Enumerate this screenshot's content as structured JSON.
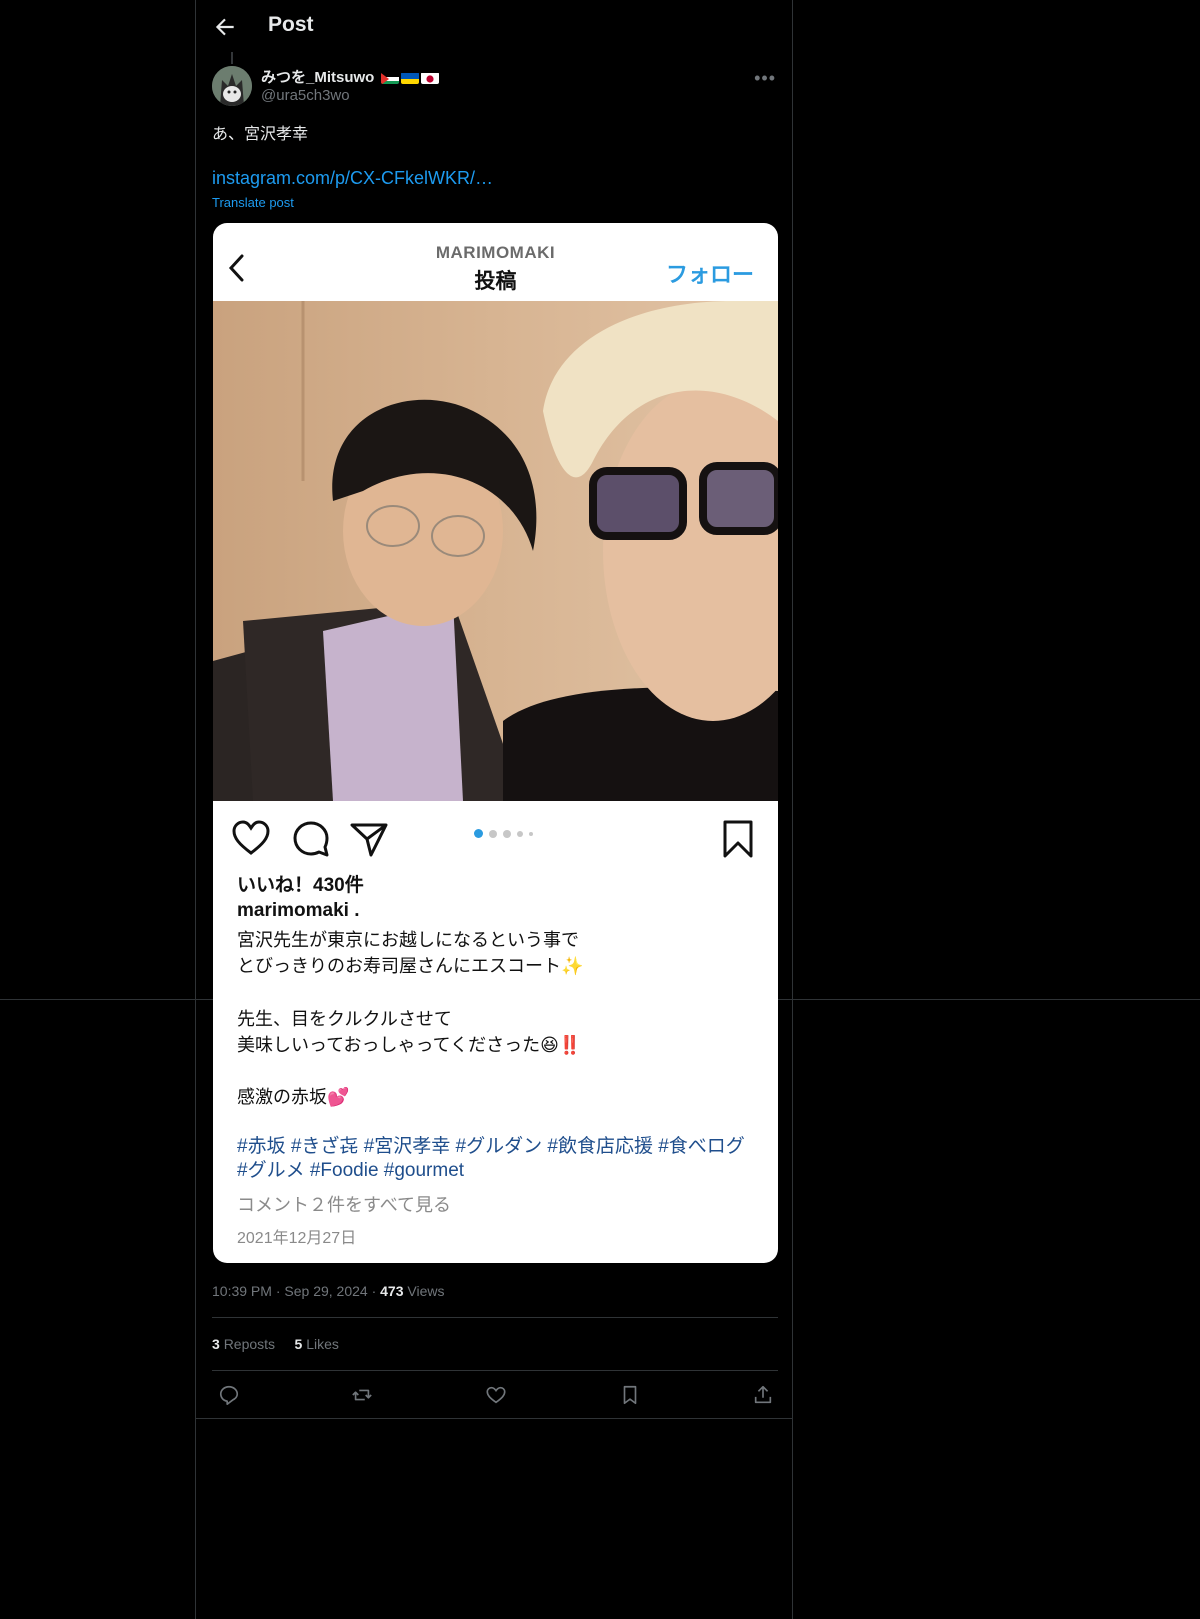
{
  "header": {
    "title": "Post"
  },
  "author": {
    "name": "みつを_Mitsuwo",
    "handle": "@ura5ch3wo"
  },
  "post": {
    "text": "あ、宮沢孝幸",
    "link": "instagram.com/p/CX-CFkelWKR/…",
    "translate": "Translate post",
    "time": "10:39 PM",
    "date": "Sep 29, 2024",
    "views_count": "473",
    "views_label": "Views",
    "reposts_count": "3",
    "reposts_label": "Reposts",
    "likes_count": "5",
    "likes_label": "Likes"
  },
  "instagram": {
    "username": "MARIMOMAKI",
    "title": "投稿",
    "follow": "フォロー",
    "likes": "いいね！430件",
    "account": "marimomaki .",
    "caption_lines": [
      "宮沢先生が東京にお越しになるという事で",
      "とびっきりのお寿司屋さんにエスコート✨",
      "先生、目をクルクルさせて",
      "美味しいっておっしゃってくださった😆‼️",
      "感激の赤坂💕"
    ],
    "hashtags": "#赤坂 #きざ㐂 #宮沢孝幸 #グルダン #飲食店応援 #食べログ #グルメ #Foodie #gourmet",
    "comments": "コメント２件をすべて見る",
    "date": "2021年12月27日"
  },
  "colors": {
    "background": "#000000",
    "link": "#1d9bf0",
    "ig_accent": "#2b9be0"
  },
  "icons": [
    "back-arrow-icon",
    "more-icon",
    "heart-icon",
    "comment-icon",
    "send-icon",
    "bookmark-icon",
    "reply-icon",
    "repost-icon",
    "like-icon",
    "share-icon"
  ]
}
